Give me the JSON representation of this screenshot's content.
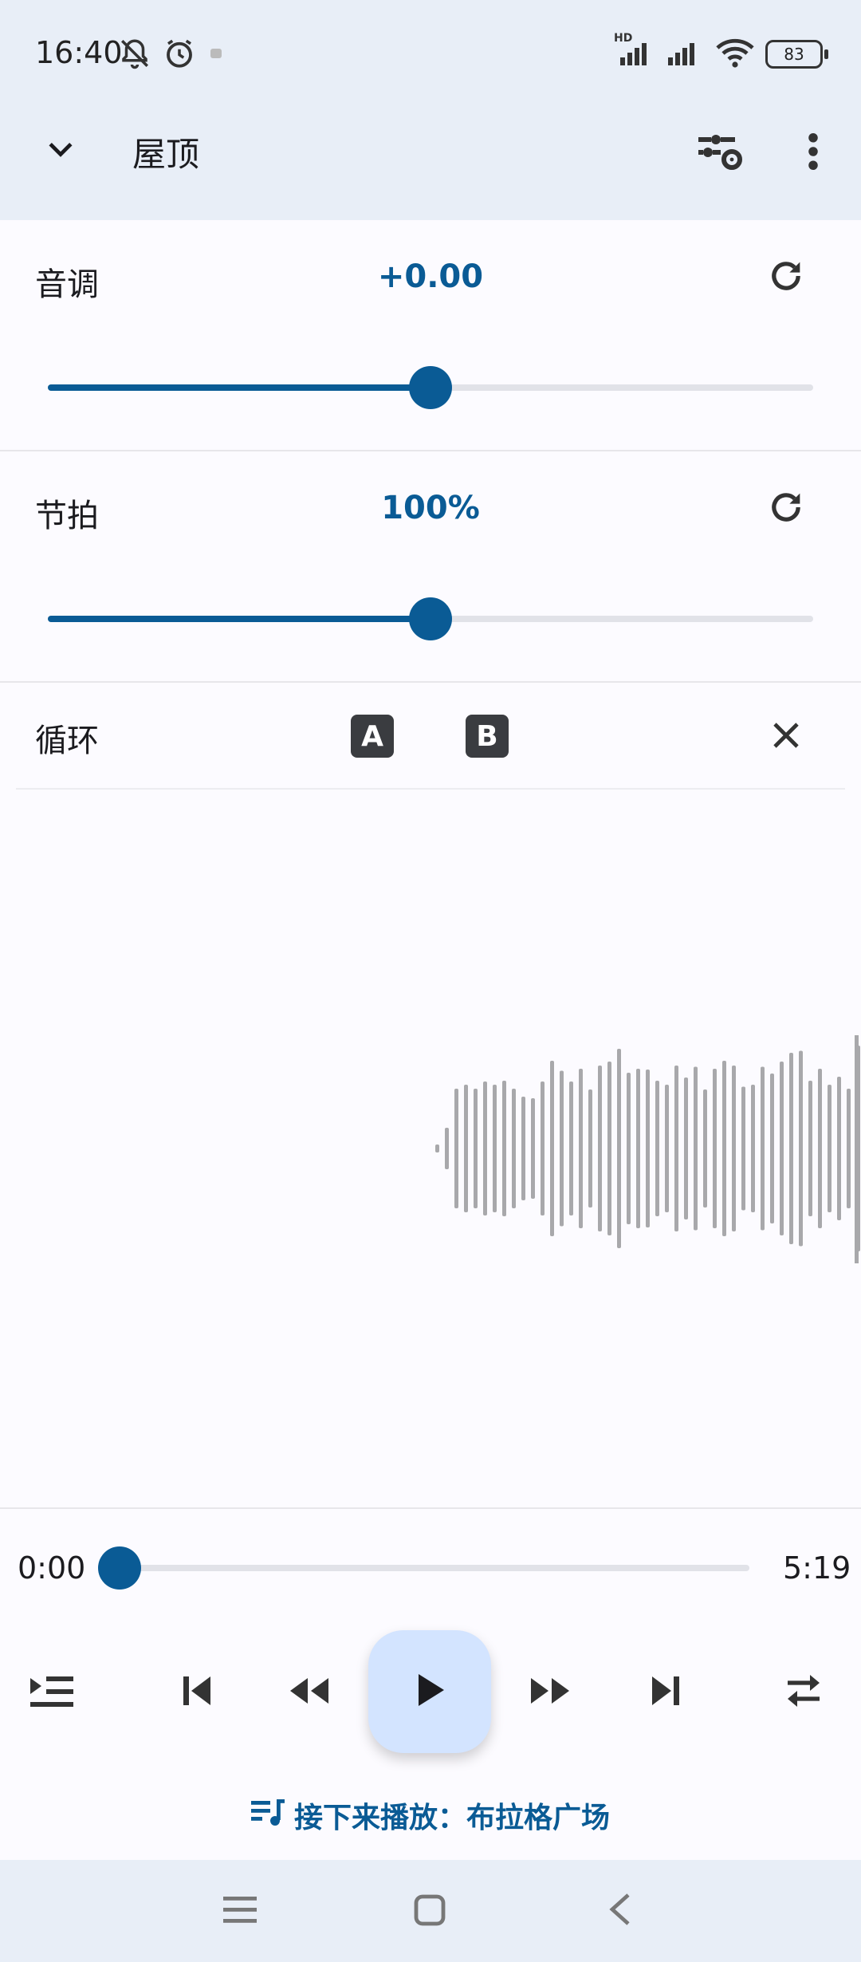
{
  "status_bar": {
    "time": "16:40",
    "battery": "83",
    "network": "HD",
    "icons": [
      "mute-icon",
      "alarm-icon",
      "notification-icon",
      "signal-icon",
      "signal-icon",
      "wifi-icon",
      "battery-icon"
    ]
  },
  "app_bar": {
    "title": "屋顶",
    "icons": [
      "chevron-down-icon",
      "equalizer-settings-icon",
      "more-vert-icon"
    ]
  },
  "pitch": {
    "label": "音调",
    "value": "+0.00",
    "level": 0.5
  },
  "tempo": {
    "label": "节拍",
    "value": "100%",
    "level": 0.5
  },
  "loop": {
    "label": "循环",
    "a_label": "A",
    "b_label": "B"
  },
  "playback": {
    "current_time": "0:00",
    "total_time": "5:19",
    "progress": 0.0
  },
  "controls": [
    "queue-icon",
    "skip-previous-icon",
    "rewind-icon",
    "play-icon",
    "fast-forward-icon",
    "skip-next-icon",
    "repeat-icon"
  ],
  "up_next": {
    "text": "接下来播放：布拉格广场"
  },
  "accent_color": "#0a5b95"
}
